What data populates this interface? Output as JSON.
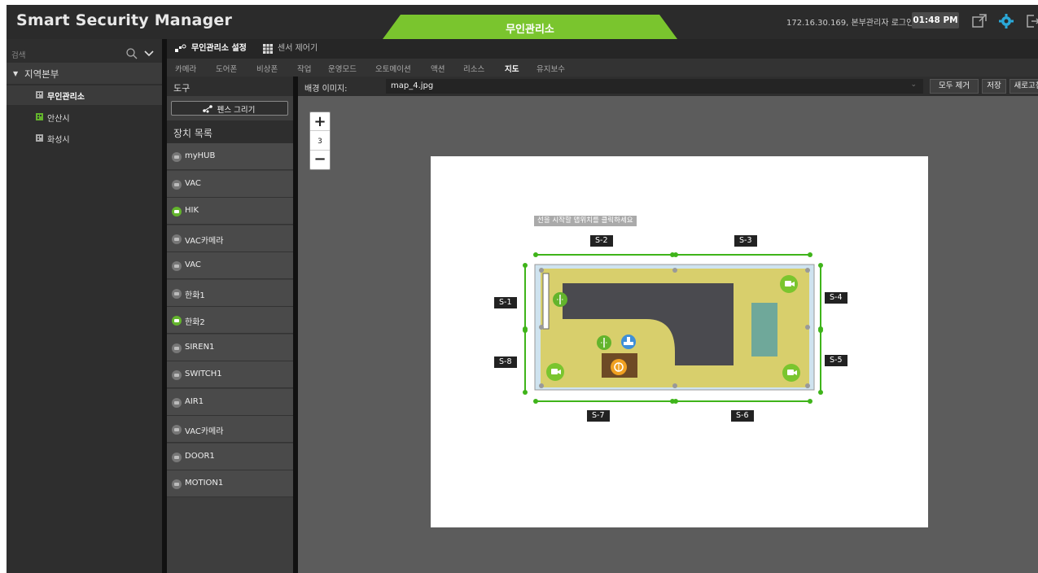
{
  "header": {
    "app_title": "Smart Security Manager",
    "center_tab": "무인관리소",
    "login_info": "172.16.30.169, 본부관리자 로그인",
    "clock": "01:48 PM",
    "icons": [
      "expand-icon",
      "gear-icon",
      "logout-icon"
    ],
    "accent_color": "#7ac52e"
  },
  "sidebar": {
    "search_placeholder": "검색",
    "root_label": "지역본부",
    "items": [
      {
        "label": "무인관리소",
        "selected": true
      },
      {
        "label": "안산시",
        "selected": false
      },
      {
        "label": "화성시",
        "selected": false
      }
    ]
  },
  "top_tabs": [
    {
      "label": "무인관리소 설정",
      "active": true
    },
    {
      "label": "센서 제어기",
      "active": false
    }
  ],
  "sub_tabs": [
    {
      "label": "카메라",
      "active": false
    },
    {
      "label": "도어폰",
      "active": false
    },
    {
      "label": "비상폰",
      "active": false
    },
    {
      "label": "작업",
      "active": false
    },
    {
      "label": "운영모드",
      "active": false
    },
    {
      "label": "오토메이션",
      "active": false
    },
    {
      "label": "액션",
      "active": false
    },
    {
      "label": "리소스",
      "active": false
    },
    {
      "label": "지도",
      "active": true
    },
    {
      "label": "유지보수",
      "active": false
    }
  ],
  "tools": {
    "header": "도구",
    "fence_button": "펜스 그리기",
    "device_list_header": "장치 목록",
    "devices": [
      {
        "label": "myHUB",
        "online": false
      },
      {
        "label": "VAC",
        "online": false
      },
      {
        "label": "HIK",
        "online": true
      },
      {
        "label": "VAC카메라",
        "online": false
      },
      {
        "label": "VAC",
        "online": false
      },
      {
        "label": "한화1",
        "online": false
      },
      {
        "label": "한화2",
        "online": true
      },
      {
        "label": "SIREN1",
        "online": false
      },
      {
        "label": "SWITCH1",
        "online": false
      },
      {
        "label": "AIR1",
        "online": false
      },
      {
        "label": "VAC카메라",
        "online": false
      },
      {
        "label": "DOOR1",
        "online": false
      },
      {
        "label": "MOTION1",
        "online": false
      }
    ]
  },
  "map": {
    "bg_label": "배경 이미지:",
    "bg_value": "map_4.jpg",
    "buttons": {
      "clear": "모두 제거",
      "save": "저장",
      "refresh": "새로고침"
    },
    "zoom_level": "3",
    "hint": "선을 시작할 맵위치를 클릭하세요",
    "segments": [
      "S-1",
      "S-2",
      "S-3",
      "S-4",
      "S-5",
      "S-6",
      "S-7",
      "S-8"
    ]
  }
}
